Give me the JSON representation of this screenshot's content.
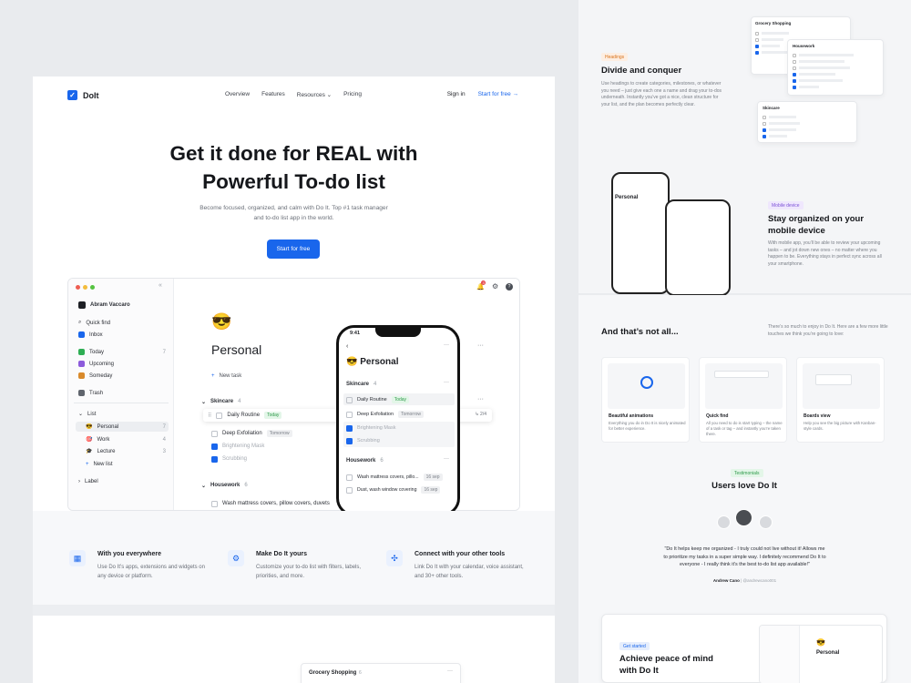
{
  "nav": {
    "brand": "DoIt",
    "links": [
      "Overview",
      "Features",
      "Resources",
      "Pricing"
    ],
    "signin": "Sign in",
    "start": "Start for free →"
  },
  "hero": {
    "line1": "Get it done for REAL with",
    "line2": "Powerful To-do list",
    "sub1": "Become focused, organized, and calm with Do It. Top #1 task manager",
    "sub2": "and to-do list app in the world.",
    "cta": "Start for free"
  },
  "sidebar": {
    "user": "Abram Vaccaro",
    "items": [
      {
        "label": "Quick find",
        "count": ""
      },
      {
        "label": "Inbox",
        "count": ""
      },
      {
        "label": "Today",
        "count": "7"
      },
      {
        "label": "Upcoming",
        "count": ""
      },
      {
        "label": "Someday",
        "count": ""
      },
      {
        "label": "Trash",
        "count": ""
      }
    ],
    "list_header": "List",
    "lists": [
      {
        "label": "Personal",
        "count": "7"
      },
      {
        "label": "Work",
        "count": "4"
      },
      {
        "label": "Lecture",
        "count": "3"
      },
      {
        "label": "New list",
        "count": ""
      }
    ],
    "label_header": "Label",
    "notif": "3"
  },
  "main": {
    "emoji": "😎",
    "title": "Personal",
    "new_task": "New task",
    "sections": [
      {
        "name": "Skincare",
        "count": "4"
      },
      {
        "name": "Housework",
        "count": "6"
      }
    ],
    "tasks": [
      {
        "label": "Daily Routine",
        "tag": "Today",
        "meta": "2/4"
      },
      {
        "label": "Deep Exfoliation",
        "tag": "Tomorrow"
      },
      {
        "label": "Brightening Mask",
        "tag": ""
      },
      {
        "label": "Scrubbing",
        "tag": ""
      }
    ],
    "housework": [
      {
        "label": "Wash mattress covers, pillow covers, duvets"
      }
    ]
  },
  "phone": {
    "time": "9:41",
    "title": "😎 Personal",
    "sec1": "Skincare",
    "sec1_count": "4",
    "sec2": "Housework",
    "sec2_count": "6",
    "tasks": [
      "Daily Routine",
      "Deep Exfoliation",
      "Brightening Mask",
      "Scrubbing"
    ],
    "tags": [
      "Today",
      "Tomorrow"
    ],
    "house": [
      "Wash mattress covers, pillo...",
      "Dust, wash window covering"
    ],
    "house_tags": [
      "16 sep",
      "16 sep"
    ]
  },
  "features": [
    {
      "title": "With you everywhere",
      "desc": "Use Do It’s apps, extensions and widgets on any device or platform."
    },
    {
      "title": "Make Do It yours",
      "desc": "Customize your to-do list with filters, labels, priorities, and more."
    },
    {
      "title": "Connect with your other tools",
      "desc": "Link Do It with your calendar, voice assistant, and 30+ other tools."
    }
  ],
  "bottom": {
    "card_title": "Grocery Shopping",
    "card_count": "6"
  },
  "headings": {
    "badge": "Headings",
    "title": "Divide and conquer",
    "desc": "Use headings to create categories, milestones, or whatever you need – just give each one a name and drag your to-dos underneath. Instantly you’ve got a nice, clean structure for your list, and the plan becomes perfectly clear."
  },
  "mobile": {
    "badge": "Mobile device",
    "title1": "Stay organized on your",
    "title2": "mobile device",
    "desc": "With mobile app, you’ll be able to review your upcoming tasks – and jot down new ones – no matter where you happen to be. Everything stays in perfect sync across all your smartphone."
  },
  "more": {
    "title": "And that’s not all...",
    "desc": "There’s so much to enjoy in Do It. Here are a few more little touches we think you’re going to love:",
    "cards": [
      {
        "title": "Beautiful animations",
        "desc": "Everything you do in Do It is nicely animated for better experience."
      },
      {
        "title": "Quick find",
        "desc": "All you need to do is start typing – the name of a task or tag – and instantly you’re taken there."
      },
      {
        "title": "Boards view",
        "desc": "Help you see the big picture with Kanban-style cards."
      }
    ]
  },
  "testimonial": {
    "badge": "Testimonials",
    "title": "Users love Do It",
    "quote1": "\"Do It helps keep me organized - I truly could not live without it! Allows me",
    "quote2": "to prioritize my tasks in a super simple way. I definitely recommend Do It to",
    "quote3": "everyone - I really think it’s the best to-do list app available!\"",
    "author": "Andrew Cano",
    "handle": "@andrewcano001"
  },
  "start": {
    "badge": "Get started",
    "title1": "Achieve peace of mind",
    "title2": "with Do It",
    "mini_title": "Personal"
  },
  "colors": {
    "accent": "#1966ec"
  }
}
